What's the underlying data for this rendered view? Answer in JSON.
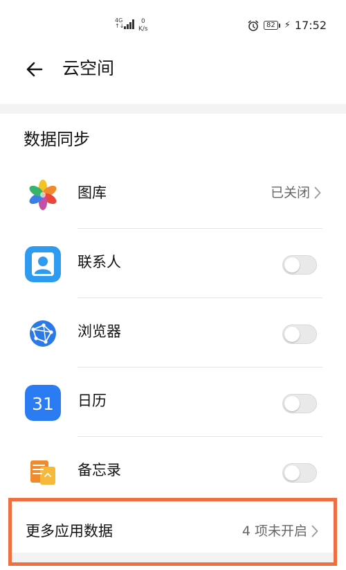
{
  "status_bar": {
    "network_type_top": "4G",
    "network_type_bottom": "↑↓",
    "speed_value": "0",
    "speed_unit": "K/s",
    "battery": "82",
    "time": "17:52",
    "alarm_icon": "alarm-clock-icon",
    "charging_icon": "lightning-icon"
  },
  "header": {
    "back_icon": "arrow-left-icon",
    "title": "云空间"
  },
  "section": {
    "title": "数据同步"
  },
  "items": [
    {
      "label": "图库",
      "icon": "photos-app-icon",
      "status": "已关闭",
      "control": "chevron"
    },
    {
      "label": "联系人",
      "icon": "contacts-app-icon",
      "control": "toggle",
      "on": false
    },
    {
      "label": "浏览器",
      "icon": "browser-app-icon",
      "control": "toggle",
      "on": false
    },
    {
      "label": "日历",
      "icon": "calendar-app-icon",
      "icon_text": "31",
      "control": "toggle",
      "on": false
    },
    {
      "label": "备忘录",
      "icon": "notes-app-icon",
      "control": "toggle",
      "on": false
    }
  ],
  "more": {
    "label": "更多应用数据",
    "status": "4 项未开启"
  },
  "colors": {
    "highlight_border": "#ee6f41",
    "contacts_blue": "#2f9bf0",
    "calendar_blue": "#2b7cf2",
    "browser_blue": "#2b79e6",
    "notes_orange": "#f08a2c"
  }
}
